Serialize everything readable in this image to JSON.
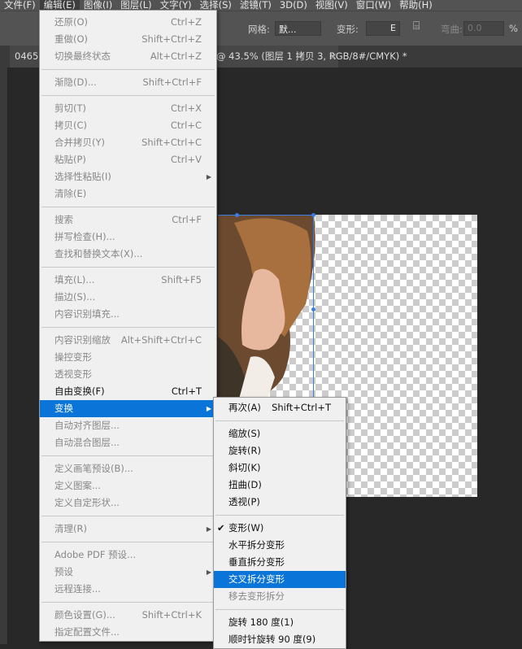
{
  "menubar": [
    "文件(F)",
    "编辑(E)",
    "图像(I)",
    "图层(L)",
    "文字(Y)",
    "选择(S)",
    "滤镜(T)",
    "3D(D)",
    "视图(V)",
    "窗口(W)",
    "帮助(H)"
  ],
  "menubar_active": 1,
  "options": {
    "grid_label": "网格:",
    "grid_value": "默...",
    "warp_label": "变形:",
    "warp_value": "E",
    "bend_label": "弯曲:",
    "bend_value": "0.0",
    "bend_unit": "%"
  },
  "tab": {
    "title_left": "0465",
    "title_right": "@ 43.5% (图层 1 拷贝 3, RGB/8#/CMYK) *",
    "close": "×"
  },
  "accent": "#0a74d8",
  "edit_menu": [
    {
      "label": "还原(O)",
      "shortcut": "Ctrl+Z"
    },
    {
      "label": "重做(O)",
      "shortcut": "Shift+Ctrl+Z"
    },
    {
      "label": "切换最终状态",
      "shortcut": "Alt+Ctrl+Z"
    },
    {
      "sep": true
    },
    {
      "label": "渐隐(D)...",
      "shortcut": "Shift+Ctrl+F"
    },
    {
      "sep": true
    },
    {
      "label": "剪切(T)",
      "shortcut": "Ctrl+X"
    },
    {
      "label": "拷贝(C)",
      "shortcut": "Ctrl+C"
    },
    {
      "label": "合并拷贝(Y)",
      "shortcut": "Shift+Ctrl+C"
    },
    {
      "label": "粘贴(P)",
      "shortcut": "Ctrl+V"
    },
    {
      "label": "选择性粘贴(I)",
      "submenu": true
    },
    {
      "label": "清除(E)"
    },
    {
      "sep": true
    },
    {
      "label": "搜索",
      "shortcut": "Ctrl+F"
    },
    {
      "label": "拼写检查(H)..."
    },
    {
      "label": "查找和替换文本(X)..."
    },
    {
      "sep": true
    },
    {
      "label": "填充(L)...",
      "shortcut": "Shift+F5"
    },
    {
      "label": "描边(S)..."
    },
    {
      "label": "内容识别填充..."
    },
    {
      "sep": true
    },
    {
      "label": "内容识别缩放",
      "shortcut": "Alt+Shift+Ctrl+C"
    },
    {
      "label": "操控变形"
    },
    {
      "label": "透视变形"
    },
    {
      "label": "自由变换(F)",
      "shortcut": "Ctrl+T",
      "enabled": true
    },
    {
      "label": "变换",
      "submenu": true,
      "highlighted": true
    },
    {
      "label": "自动对齐图层..."
    },
    {
      "label": "自动混合图层..."
    },
    {
      "sep": true
    },
    {
      "label": "定义画笔预设(B)..."
    },
    {
      "label": "定义图案..."
    },
    {
      "label": "定义自定形状..."
    },
    {
      "sep": true
    },
    {
      "label": "清理(R)",
      "submenu": true
    },
    {
      "sep": true
    },
    {
      "label": "Adobe PDF 预设..."
    },
    {
      "label": "预设",
      "submenu": true
    },
    {
      "label": "远程连接..."
    },
    {
      "sep": true
    },
    {
      "label": "颜色设置(G)...",
      "shortcut": "Shift+Ctrl+K"
    },
    {
      "label": "指定配置文件..."
    }
  ],
  "transform_menu": [
    {
      "label": "再次(A)",
      "shortcut": "Shift+Ctrl+T",
      "enabled": true
    },
    {
      "sep": true
    },
    {
      "label": "缩放(S)",
      "enabled": true
    },
    {
      "label": "旋转(R)",
      "enabled": true
    },
    {
      "label": "斜切(K)",
      "enabled": true
    },
    {
      "label": "扭曲(D)",
      "enabled": true
    },
    {
      "label": "透视(P)",
      "enabled": true
    },
    {
      "sep": true
    },
    {
      "label": "变形(W)",
      "enabled": true,
      "checked": true
    },
    {
      "label": "水平拆分变形",
      "enabled": true
    },
    {
      "label": "垂直拆分变形",
      "enabled": true
    },
    {
      "label": "交叉拆分变形",
      "enabled": true,
      "highlighted": true
    },
    {
      "label": "移去变形拆分"
    },
    {
      "sep": true
    },
    {
      "label": "旋转 180 度(1)",
      "enabled": true
    },
    {
      "label": "顺时针旋转 90 度(9)",
      "enabled": true
    }
  ]
}
